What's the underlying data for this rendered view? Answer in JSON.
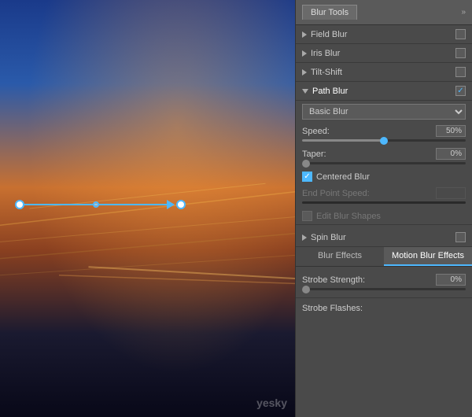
{
  "panel": {
    "tab_label": "Blur Tools",
    "blur_tools": [
      {
        "id": "field-blur",
        "label": "Field Blur",
        "expanded": false,
        "checked": false
      },
      {
        "id": "iris-blur",
        "label": "Iris Blur",
        "expanded": false,
        "checked": false
      },
      {
        "id": "tilt-shift",
        "label": "Tilt-Shift",
        "expanded": false,
        "checked": false
      },
      {
        "id": "path-blur",
        "label": "Path Blur",
        "expanded": true,
        "checked": true
      },
      {
        "id": "spin-blur",
        "label": "Spin Blur",
        "expanded": false,
        "checked": false
      }
    ],
    "path_blur": {
      "dropdown_label": "Basic Blur",
      "speed_label": "Speed:",
      "speed_value": "50%",
      "speed_pct": 50,
      "taper_label": "Taper:",
      "taper_value": "0%",
      "taper_pct": 0,
      "centered_blur_label": "Centered Blur",
      "centered_blur_checked": true,
      "end_point_speed_label": "End Point Speed:",
      "edit_blur_shapes_label": "Edit Blur Shapes"
    },
    "bottom_tabs": [
      {
        "id": "blur-effects",
        "label": "Blur Effects",
        "active": false
      },
      {
        "id": "motion-blur-effects",
        "label": "Motion Blur Effects",
        "active": true
      }
    ],
    "motion_effects": {
      "strobe_strength_label": "Strobe Strength:",
      "strobe_strength_value": "0%",
      "strobe_strength_pct": 0,
      "strobe_flashes_label": "Strobe Flashes:"
    }
  }
}
